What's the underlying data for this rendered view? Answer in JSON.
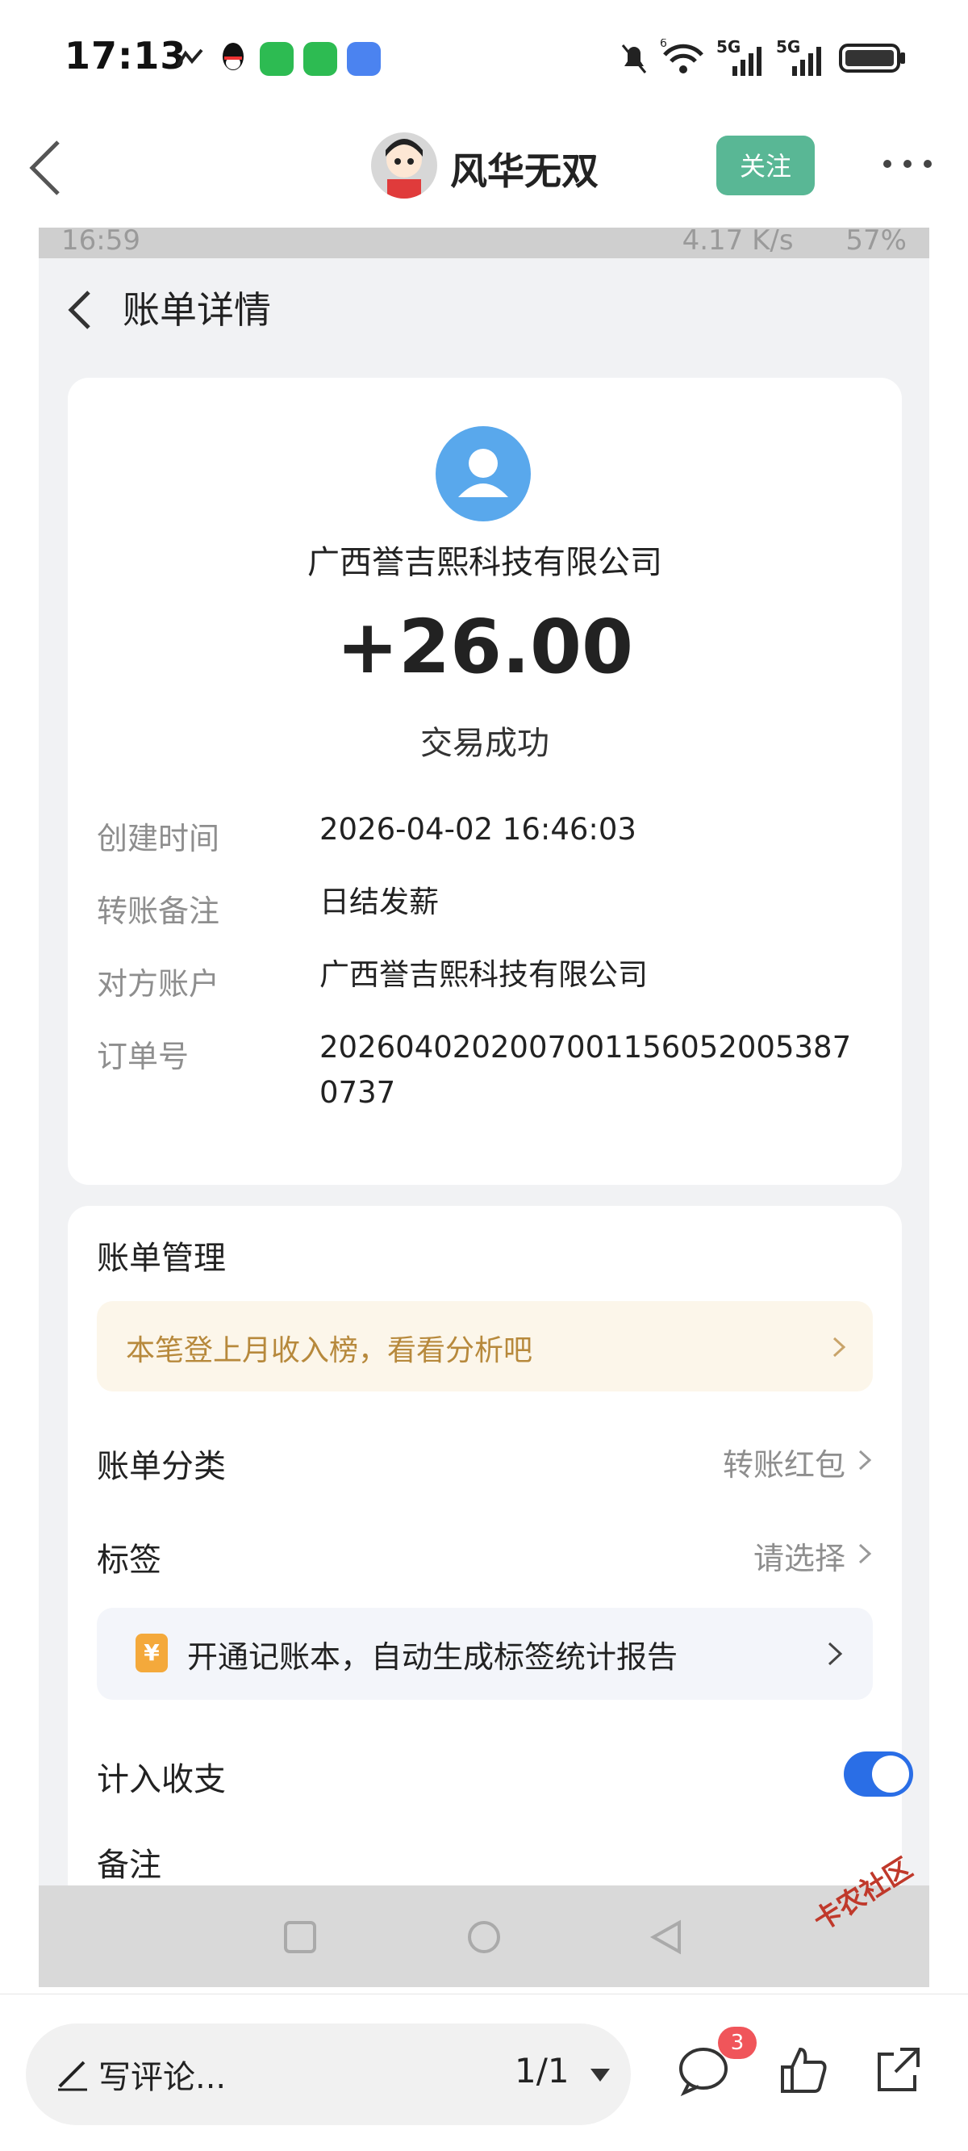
{
  "status_bar": {
    "time": "17:13",
    "signal_1": "5G",
    "signal_2": "5G",
    "wifi_label": "6"
  },
  "header": {
    "username": "风华无双",
    "follow_label": "关注"
  },
  "inner_status_bar": {
    "time": "16:59",
    "speed": "4.17 K/s",
    "battery": "57%"
  },
  "bill": {
    "page_title": "账单详情",
    "merchant_name": "广西誉吉熙科技有限公司",
    "amount": "+26.00",
    "status": "交易成功",
    "rows": [
      {
        "label": "创建时间",
        "value": "2026-04-02 16:46:03"
      },
      {
        "label": "转账备注",
        "value": "日结发薪"
      },
      {
        "label": "对方账户",
        "value": "广西誉吉熙科技有限公司"
      },
      {
        "label": "订单号",
        "value": "20260402020070011560520053870737"
      }
    ]
  },
  "management": {
    "title": "账单管理",
    "analysis_banner": "本笔登上月收入榜，看看分析吧",
    "category_label": "账单分类",
    "category_value": "转账红包",
    "tag_label": "标签",
    "tag_value": "请选择",
    "promo_icon": "¥",
    "promo_text": "开通记账本，自动生成标签统计报告",
    "include_label": "计入收支",
    "include_enabled": true,
    "note_label": "备注"
  },
  "bottom_bar": {
    "comment_placeholder": "写评论...",
    "page_indicator": "1/1",
    "comment_badge": "3"
  },
  "watermark": "卡农社区",
  "colors": {
    "follow_bg": "#59b795",
    "accent_blue": "#2a6ee6",
    "banner_text": "#b7893c",
    "badge_red": "#f0555a"
  }
}
